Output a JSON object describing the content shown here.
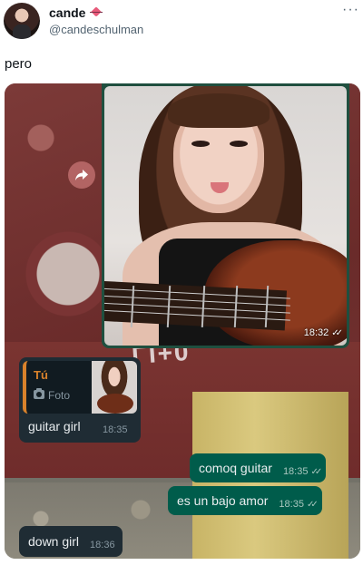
{
  "tweet": {
    "display_name": "cande",
    "handle": "@candeschulman",
    "more": "···",
    "text": "pero"
  },
  "media": {
    "graffiti": "ΓΙ+0",
    "photo_message": {
      "time": "18:32",
      "ticks": "✓✓"
    },
    "reply_message": {
      "quote_author": "Tú",
      "quote_kind": "Foto",
      "text": "guitar girl",
      "time": "18:35"
    },
    "outgoing": [
      {
        "text": "comoq guitar",
        "time": "18:35",
        "ticks": "✓✓"
      },
      {
        "text": "es un bajo amor",
        "time": "18:35",
        "ticks": "✓✓"
      }
    ],
    "incoming_last": {
      "text": "down girl",
      "time": "18:36"
    }
  },
  "colors": {
    "incoming_bubble": "#1f2c34",
    "outgoing_bubble": "#005c4b",
    "quote_accent": "#d9822b"
  },
  "icons": [
    "heart-emoji-icon",
    "more-icon",
    "forward-icon",
    "camera-icon",
    "double-check-icon"
  ]
}
